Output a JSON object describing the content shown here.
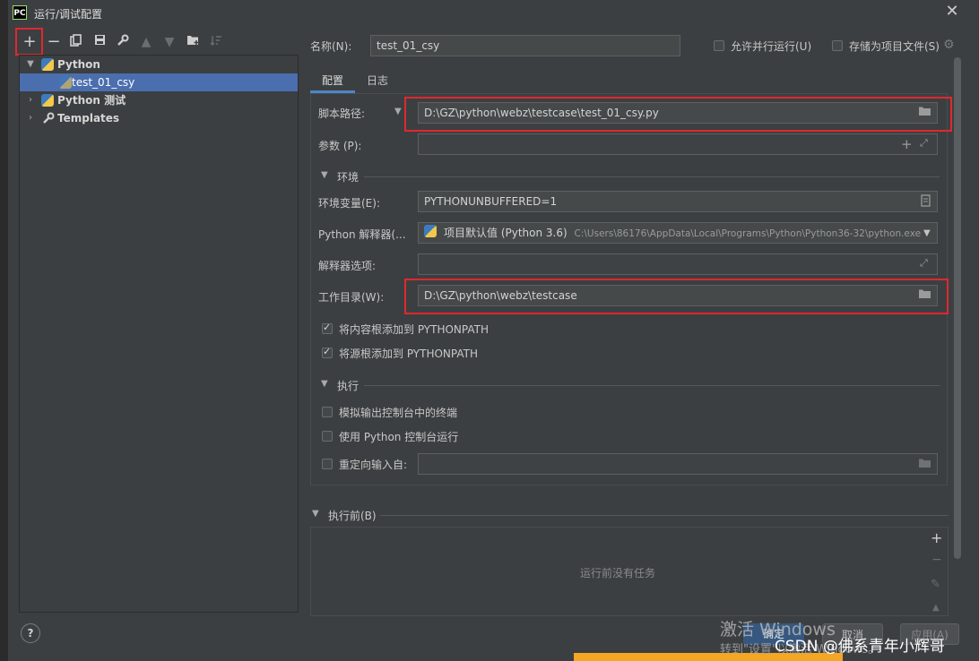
{
  "window": {
    "title": "运行/调试配置",
    "app_icon_text": "PC"
  },
  "toolbar": {
    "items": [
      "plus-icon",
      "minus-icon",
      "copy-icon",
      "save-icon",
      "wrench-icon",
      "arrow-up-icon",
      "arrow-down-icon",
      "folder-add-icon",
      "sort-icon"
    ]
  },
  "tree": {
    "items": [
      {
        "label": "Python",
        "expanded": true
      },
      {
        "label": "test_01_csy",
        "selected": true
      },
      {
        "label": "Python 测试",
        "expanded": false
      },
      {
        "label": "Templates",
        "expanded": false
      }
    ]
  },
  "header": {
    "name_label": "名称(N):",
    "name_value": "test_01_csy",
    "allow_parallel_label": "允许并行运行(U)",
    "store_as_project_file_label": "存储为项目文件(S)"
  },
  "tabs": [
    {
      "label": "配置",
      "active": true
    },
    {
      "label": "日志",
      "active": false
    }
  ],
  "config": {
    "script_path_label": "脚本路径:",
    "script_path_value": "D:\\GZ\\python\\webz\\testcase\\test_01_csy.py",
    "params_label": "参数 (P):",
    "params_value": "",
    "env_section": "环境",
    "env_vars_label": "环境变量(E):",
    "env_vars_value": "PYTHONUNBUFFERED=1",
    "interpreter_label": "Python 解释器(...",
    "interpreter_value": "项目默认值 (Python 3.6)",
    "interpreter_path": "C:\\Users\\86176\\AppData\\Local\\Programs\\Python\\Python36-32\\python.exe",
    "interpreter_options_label": "解释器选项:",
    "interpreter_options_value": "",
    "workdir_label": "工作目录(W):",
    "workdir_value": "D:\\GZ\\python\\webz\\testcase",
    "add_content_roots_label": "将内容根添加到 PYTHONPATH",
    "add_content_roots_checked": true,
    "add_source_roots_label": "将源根添加到 PYTHONPATH",
    "add_source_roots_checked": true,
    "exec_section": "执行",
    "emulate_terminal_label": "模拟输出控制台中的终端",
    "emulate_terminal_checked": false,
    "python_console_label": "使用 Python 控制台运行",
    "python_console_checked": false,
    "redirect_input_label": "重定向输入自:",
    "redirect_input_checked": false,
    "redirect_input_value": ""
  },
  "before_launch": {
    "section": "执行前(B)",
    "empty_text": "运行前没有任务"
  },
  "footer": {
    "help_label": "?",
    "ok_label": "确定",
    "cancel_label": "取消",
    "apply_label": "应用(A)"
  },
  "watermark": {
    "line1": "激活 Windows",
    "line2": "转到\"设置\"以激活 Windows。",
    "csdn": "CSDN @佛系青年小辉哥"
  }
}
